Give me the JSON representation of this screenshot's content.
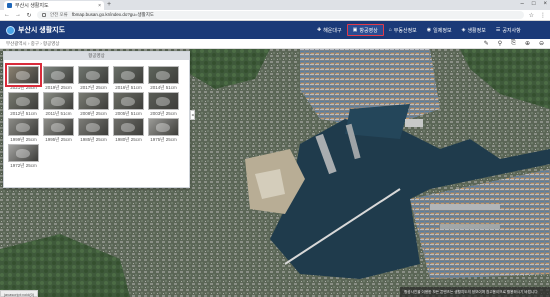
{
  "browser": {
    "tab_title": "부산시 생활지도",
    "tab_close": "×",
    "new_tab": "+",
    "window_controls": [
      "–",
      "□",
      "×"
    ],
    "nav": [
      "←",
      "→",
      "↻"
    ],
    "security_label": "안전 오류",
    "url": "fbmap.busan.go.kr/index.do?gu=생활지도",
    "right_icons": [
      "☆",
      "⋮"
    ]
  },
  "app": {
    "title": "부산시 생활지도",
    "menu": [
      {
        "icon": "✚",
        "label": "해운대구"
      },
      {
        "icon": "▣",
        "label": "항공영상"
      },
      {
        "icon": "⌂",
        "label": "부동산정보"
      },
      {
        "icon": "◉",
        "label": "일제정보"
      },
      {
        "icon": "◈",
        "label": "생활정보"
      },
      {
        "icon": "☰",
        "label": "공지사항"
      }
    ]
  },
  "subbar": {
    "breadcrumb": "부산광역시 › 중구 › 항공영상",
    "tools": [
      "✎",
      "⚲",
      "⎘",
      "⊕",
      "⊖"
    ]
  },
  "panel": {
    "title": "항공영상",
    "collapse": "◂",
    "thumbs": [
      {
        "label": "2021년 25cm",
        "color": "#8a8170",
        "selected": true
      },
      {
        "label": "2019년 25cm",
        "color": "#7f8680",
        "selected": false
      },
      {
        "label": "2017년 25cm",
        "color": "#6f756e",
        "selected": false
      },
      {
        "label": "2016년 51cm",
        "color": "#6a6f68",
        "selected": false
      },
      {
        "label": "2014년 51cm",
        "color": "#5e655c",
        "selected": false
      },
      {
        "label": "2012년 51cm",
        "color": "#76796f",
        "selected": false
      },
      {
        "label": "2011년 51cm",
        "color": "#8a8d85",
        "selected": false
      },
      {
        "label": "2008년 25cm",
        "color": "#7a7c74",
        "selected": false
      },
      {
        "label": "2005년 51cm",
        "color": "#6c6e66",
        "selected": false
      },
      {
        "label": "2003년 25cm",
        "color": "#5a5d57",
        "selected": false
      },
      {
        "label": "1999년 25cm",
        "color": "#8b8b86",
        "selected": false
      },
      {
        "label": "1995년 25cm",
        "color": "#8f8f8a",
        "selected": false
      },
      {
        "label": "1985년 25cm",
        "color": "#7c7c77",
        "selected": false
      },
      {
        "label": "1980년 25cm",
        "color": "#6f6f6a",
        "selected": false
      },
      {
        "label": "1975년 25cm",
        "color": "#9a9a96",
        "selected": false
      },
      {
        "label": "1972년 25cm",
        "color": "#a2a2a0",
        "selected": false
      }
    ]
  },
  "map": {
    "notice": "항공사진을 이용한 모든 콘텐츠는 생활지도의 정보이며 참고용이므로 활용하시기 바랍니다",
    "status": "javascript:void(0)"
  }
}
